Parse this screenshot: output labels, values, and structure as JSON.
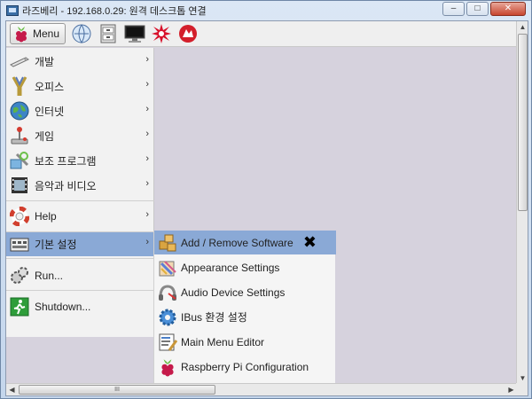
{
  "window": {
    "title": "라즈베리 - 192.168.0.29: 원격 데스크톱 연결",
    "min_label": "–",
    "max_label": "□",
    "close_label": "✕"
  },
  "toolbar": {
    "menu_label": "Menu",
    "icons": [
      "raspberry-icon",
      "globe-icon",
      "file-cabinet-icon",
      "monitor-icon",
      "burst-icon",
      "wolfram-icon"
    ]
  },
  "menu": {
    "items": [
      {
        "label": "개발",
        "icon": "development-icon",
        "submenu": true
      },
      {
        "label": "오피스",
        "icon": "office-icon",
        "submenu": true
      },
      {
        "label": "인터넷",
        "icon": "internet-icon",
        "submenu": true
      },
      {
        "label": "게임",
        "icon": "joystick-icon",
        "submenu": true
      },
      {
        "label": "보조 프로그램",
        "icon": "accessories-icon",
        "submenu": true
      },
      {
        "label": "음악과 비디오",
        "icon": "film-icon",
        "submenu": true
      },
      {
        "label": "Help",
        "icon": "lifebuoy-icon",
        "submenu": true
      },
      {
        "label": "기본 설정",
        "icon": "preferences-icon",
        "submenu": true,
        "active": true
      },
      {
        "label": "Run...",
        "icon": "run-icon",
        "submenu": false
      },
      {
        "label": "Shutdown...",
        "icon": "exit-icon",
        "submenu": false
      }
    ],
    "arrow": "›"
  },
  "submenu": {
    "items": [
      {
        "label": "Add / Remove Software",
        "icon": "package-icon",
        "active": true
      },
      {
        "label": "Appearance Settings",
        "icon": "appearance-icon"
      },
      {
        "label": "Audio Device Settings",
        "icon": "audio-icon"
      },
      {
        "label": "IBus 환경 설정",
        "icon": "gear-icon"
      },
      {
        "label": "Main Menu Editor",
        "icon": "editor-icon"
      },
      {
        "label": "Raspberry Pi Configuration",
        "icon": "raspberry-icon"
      }
    ],
    "close_mark": "✖"
  },
  "scrollbar": {
    "up": "▲",
    "down": "▼",
    "left": "◀",
    "right": "▶",
    "grip": "III"
  },
  "colors": {
    "highlight": "#8aa9d6",
    "raspberry": "#c51a4a",
    "leaf": "#6cc04a"
  }
}
